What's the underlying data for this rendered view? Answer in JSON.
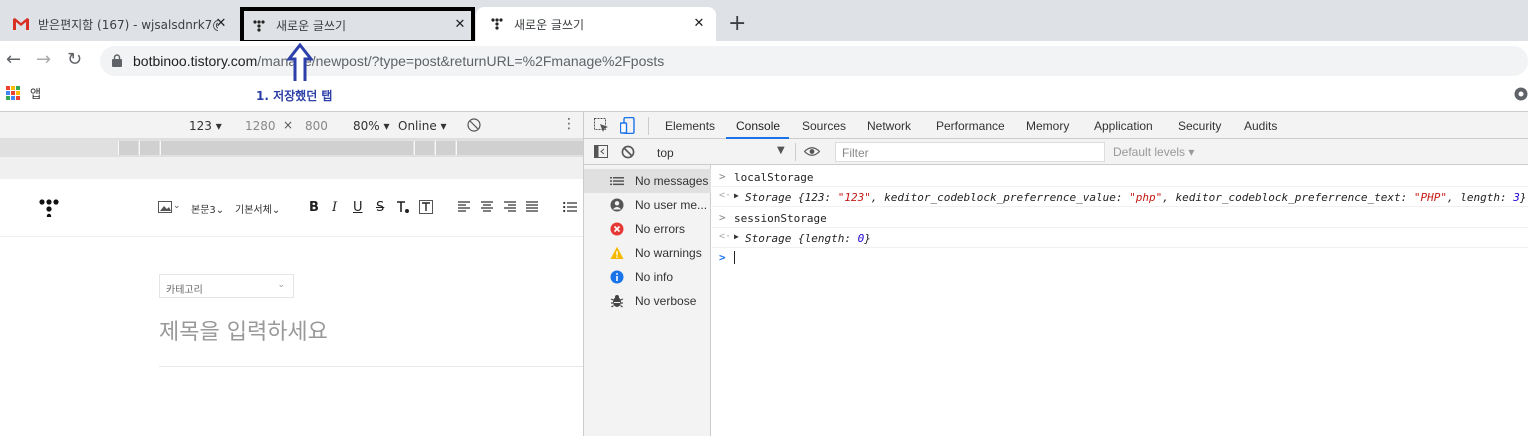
{
  "browser": {
    "tabs": [
      {
        "title": "받은편지함 (167) - wjsalsdnrk7@",
        "icon": "gmail-icon",
        "state": "inactive"
      },
      {
        "title": "새로운 글쓰기",
        "icon": "tistory-icon",
        "state": "highlighted"
      },
      {
        "title": "새로운 글쓰기",
        "icon": "tistory-icon",
        "state": "active"
      }
    ],
    "new_tab_glyph": "+",
    "close_glyph": "✕",
    "url_host": "botbinoo.tistory.com",
    "url_rest": "/manage/newpost/?type=post&returnURL=%2Fmanage%2Fposts",
    "bookmarks_label": "앱",
    "annotation": "1. 저장했던 탭",
    "annotation_color": "#2d3fa8"
  },
  "device_toolbar": {
    "device": "123",
    "width": "1280",
    "times": "×",
    "height": "800",
    "zoom": "80%",
    "network": "Online"
  },
  "editor": {
    "toolbar_items": [
      "본문3",
      "기본서체"
    ],
    "format_buttons": [
      "B",
      "I",
      "U",
      "S"
    ],
    "category_placeholder": "카테고리",
    "title_placeholder": "제목을 입력하세요"
  },
  "devtools": {
    "tabs": [
      "Elements",
      "Console",
      "Sources",
      "Network",
      "Performance",
      "Memory",
      "Application",
      "Security",
      "Audits"
    ],
    "active_tab": "Console",
    "context": "top",
    "filter_placeholder": "Filter",
    "levels": "Default levels",
    "sidebar": [
      {
        "label": "No messages",
        "icon": "list-icon"
      },
      {
        "label": "No user me...",
        "icon": "user-icon"
      },
      {
        "label": "No errors",
        "icon": "error-icon"
      },
      {
        "label": "No warnings",
        "icon": "warning-icon"
      },
      {
        "label": "No info",
        "icon": "info-icon"
      },
      {
        "label": "No verbose",
        "icon": "bug-icon"
      }
    ],
    "console_lines": [
      {
        "prefix": ">",
        "text": "localStorage"
      },
      {
        "prefix": "<·",
        "text": "Storage {123: \"123\", keditor_codeblock_preferrence_value: \"php\", keditor_codeblock_preferrence_text: \"PHP\", length: 3}"
      },
      {
        "prefix": ">",
        "text": "sessionStorage"
      },
      {
        "prefix": "<·",
        "text": "Storage {length: 0}"
      },
      {
        "prefix": ">",
        "text": ""
      }
    ]
  },
  "colors": {
    "gmail_red": "#d93025",
    "console_prompt": "#1a73e8",
    "error_red": "#e53935",
    "warning_yellow": "#f5b800",
    "info_blue": "#1a73e8"
  }
}
